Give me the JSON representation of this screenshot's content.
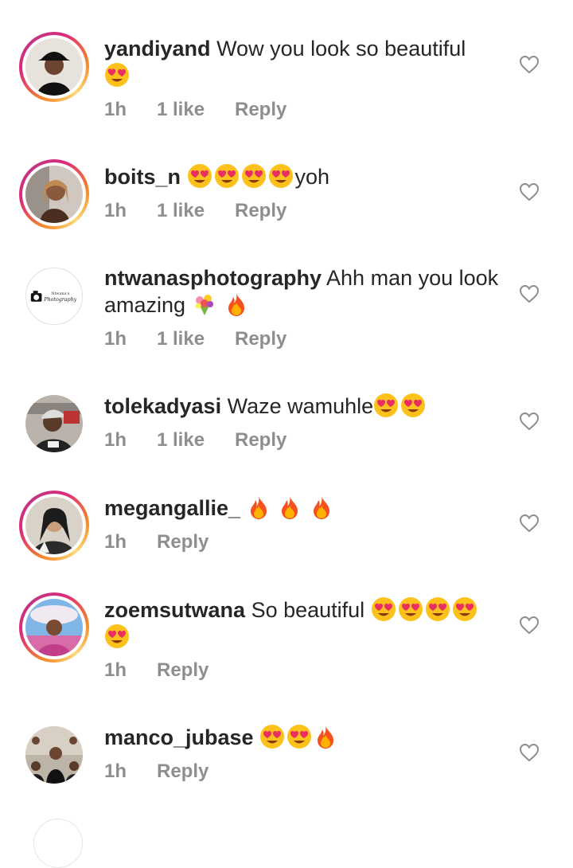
{
  "comments": [
    {
      "username": "yandiyand",
      "text": "Wow you look so beautiful",
      "emoji_suffix": [
        "heart-eyes"
      ],
      "time": "1h",
      "likes": "1 like",
      "reply": "Reply",
      "story_ring": true
    },
    {
      "username": "boits_n",
      "text": "",
      "emoji_suffix": [
        "heart-eyes",
        "heart-eyes",
        "heart-eyes",
        "heart-eyes"
      ],
      "trailing_text": "yoh",
      "time": "1h",
      "likes": "1 like",
      "reply": "Reply",
      "story_ring": true
    },
    {
      "username": "ntwanasphotography",
      "text": "Ahh man you look amazing",
      "emoji_suffix": [
        "bouquet",
        "fire"
      ],
      "time": "1h",
      "likes": "1 like",
      "reply": "Reply",
      "story_ring": false,
      "avatar_logo_text": "Ntwana's Photography"
    },
    {
      "username": "tolekadyasi",
      "text": "Waze wamuhle",
      "emoji_suffix": [
        "heart-eyes",
        "heart-eyes"
      ],
      "time": "1h",
      "likes": "1 like",
      "reply": "Reply",
      "story_ring": false
    },
    {
      "username": "megangallie_",
      "text": "",
      "emoji_suffix": [
        "fire",
        "fire",
        "fire"
      ],
      "time": "1h",
      "likes": "",
      "reply": "Reply",
      "story_ring": true
    },
    {
      "username": "zoemsutwana",
      "text": "So beautiful",
      "emoji_suffix": [
        "heart-eyes",
        "heart-eyes",
        "heart-eyes",
        "heart-eyes",
        "heart-eyes"
      ],
      "time": "1h",
      "likes": "",
      "reply": "Reply",
      "story_ring": true
    },
    {
      "username": "manco_jubase",
      "text": "",
      "emoji_suffix": [
        "heart-eyes",
        "heart-eyes",
        "fire"
      ],
      "time": "1h",
      "likes": "",
      "reply": "Reply",
      "story_ring": false
    }
  ],
  "icons": {
    "like": "heart-outline-icon"
  },
  "colors": {
    "text_primary": "#262626",
    "text_secondary": "#8e8e8e",
    "story_ring_start": "#f58529",
    "story_ring_end": "#dd2a7b"
  }
}
